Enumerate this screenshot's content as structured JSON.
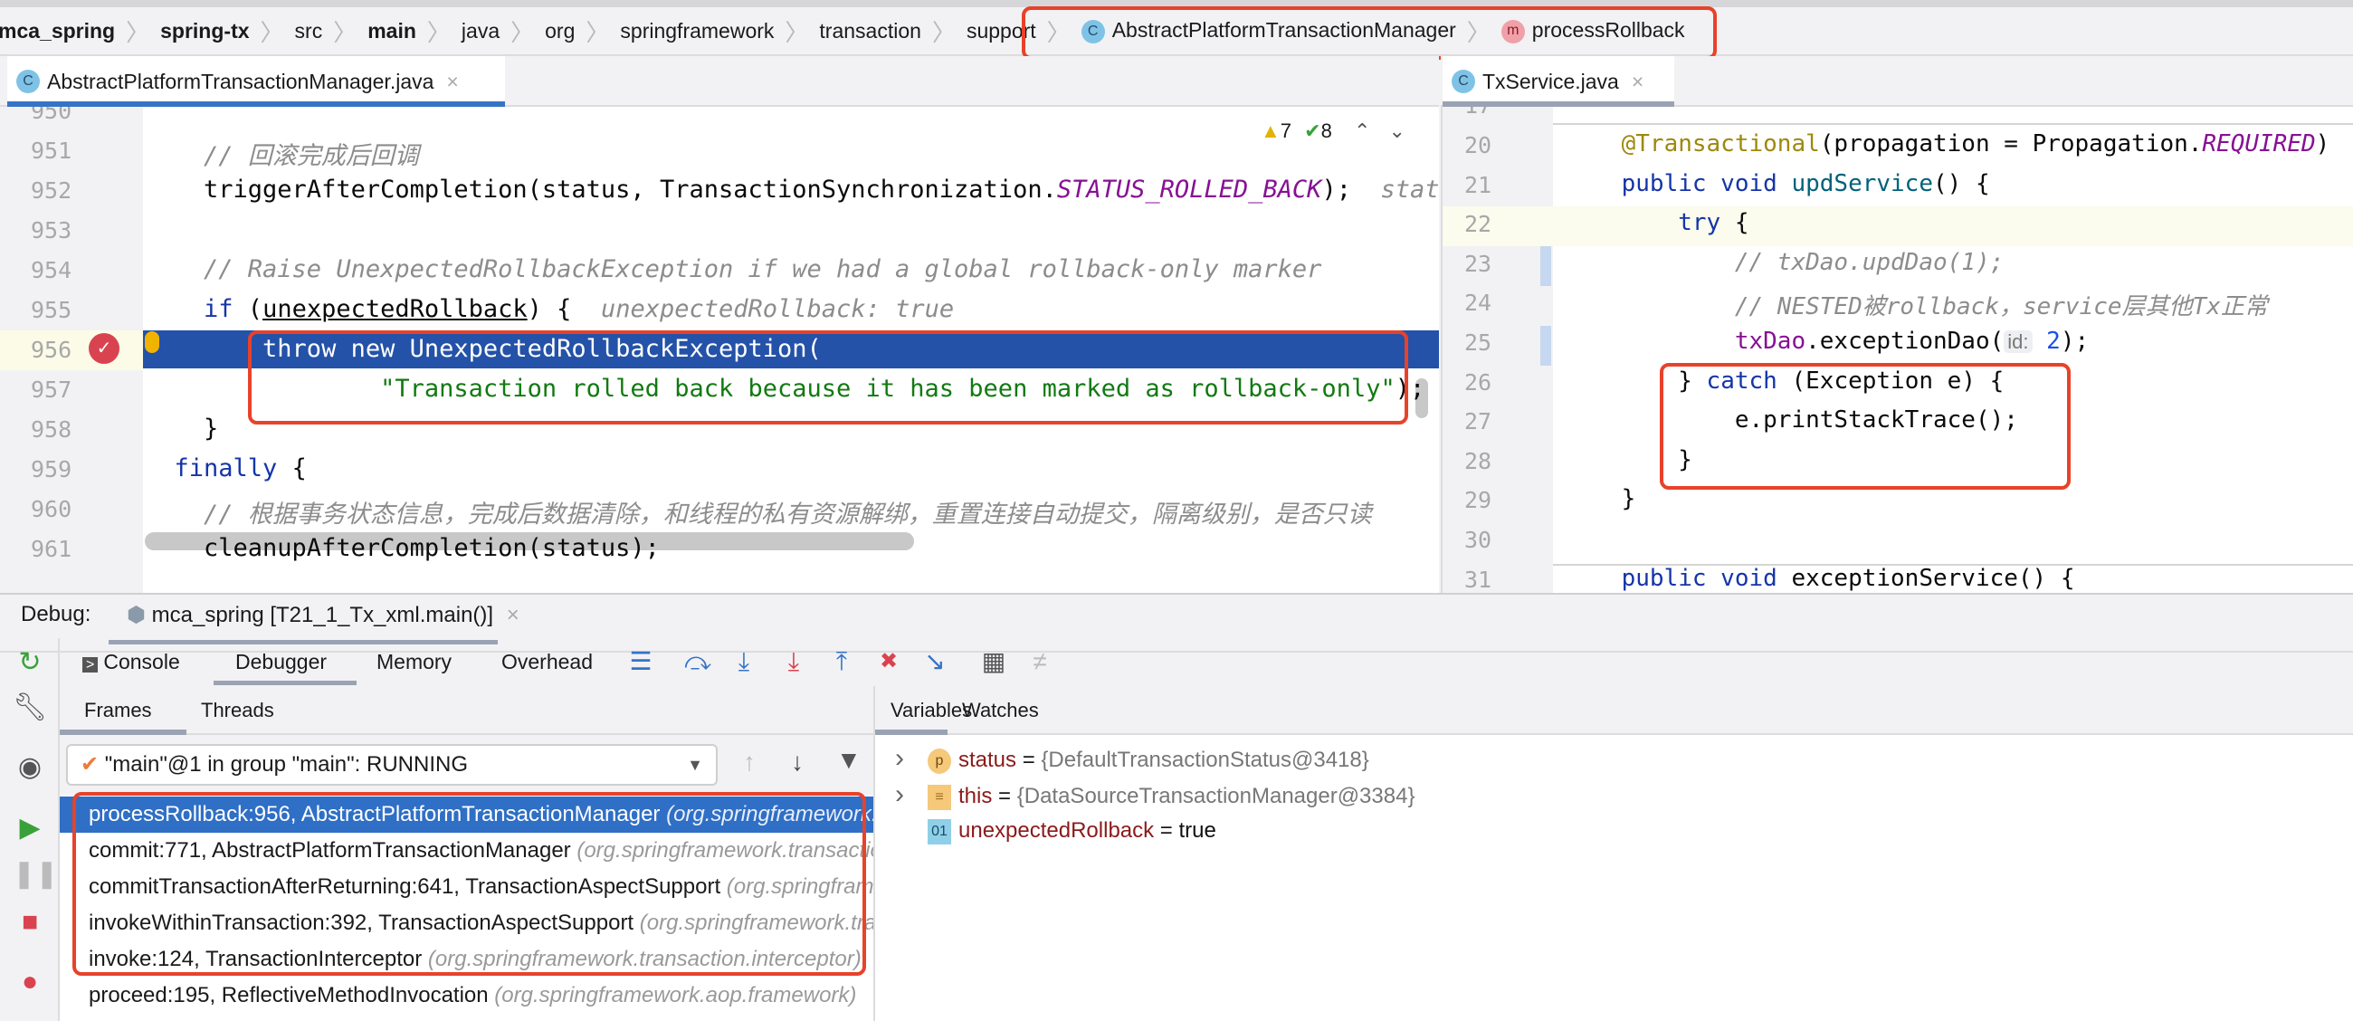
{
  "breadcrumb": {
    "items": [
      "mca_spring",
      "spring-tx",
      "src",
      "main",
      "java",
      "org",
      "springframework",
      "transaction",
      "support"
    ],
    "class_icon": "C",
    "class_name": "AbstractPlatformTransactionManager",
    "method_icon": "m",
    "method_name": "processRollback"
  },
  "left_editor": {
    "tab_label": "AbstractPlatformTransactionManager.java",
    "warnings": "7",
    "checks": "8",
    "lines": [
      {
        "num": "950",
        "tokens": []
      },
      {
        "num": "951",
        "tokens": [
          {
            "c": "cm",
            "t": "    // 回滚完成后回调"
          }
        ]
      },
      {
        "num": "952",
        "tokens": [
          {
            "c": "pl",
            "t": "    triggerAfterCompletion(status, TransactionSynchronization."
          },
          {
            "c": "cn",
            "t": "STATUS_ROLLED_BACK"
          },
          {
            "c": "pl",
            "t": ");"
          },
          {
            "c": "hn",
            "t": "  statu"
          }
        ]
      },
      {
        "num": "953",
        "tokens": []
      },
      {
        "num": "954",
        "tokens": [
          {
            "c": "cm",
            "t": "    // Raise UnexpectedRollbackException if we had a global rollback-only marker"
          }
        ]
      },
      {
        "num": "955",
        "tokens": [
          {
            "c": "kw",
            "t": "    if"
          },
          {
            "c": "pl",
            "t": " ("
          },
          {
            "c": "ul",
            "t": "unexpectedRollback"
          },
          {
            "c": "pl",
            "t": ") {"
          },
          {
            "c": "hn",
            "t": "  unexpectedRollback: true"
          }
        ]
      },
      {
        "num": "956",
        "tokens": [
          {
            "c": "hl",
            "t": "        throw new UnexpectedRollbackException("
          }
        ]
      },
      {
        "num": "957",
        "tokens": [
          {
            "c": "st",
            "t": "                \"Transaction rolled back because it has been marked as rollback-only\""
          },
          {
            "c": "pl",
            "t": ");"
          }
        ]
      },
      {
        "num": "958",
        "tokens": [
          {
            "c": "pl",
            "t": "    }"
          }
        ]
      },
      {
        "num": "959",
        "tokens": [
          {
            "c": "kw",
            "t": "  finally"
          },
          {
            "c": "pl",
            "t": " {"
          }
        ]
      },
      {
        "num": "960",
        "tokens": [
          {
            "c": "cm",
            "t": "    // 根据事务状态信息，完成后数据清除，和线程的私有资源解绑，重置连接自动提交，隔离级别，是否只读"
          }
        ]
      },
      {
        "num": "961",
        "tokens": [
          {
            "c": "pl",
            "t": "    cleanupAfterCompletion(status);"
          }
        ]
      }
    ]
  },
  "right_editor": {
    "tab_label": "TxService.java",
    "lines": [
      {
        "num": "17",
        "tokens": []
      },
      {
        "num": "20",
        "tokens": [
          {
            "c": "an",
            "t": "    @Transactional"
          },
          {
            "c": "pl",
            "t": "(propagation = Propagation."
          },
          {
            "c": "cn",
            "t": "REQUIRED"
          },
          {
            "c": "pl",
            "t": ")"
          }
        ]
      },
      {
        "num": "21",
        "tokens": [
          {
            "c": "kw",
            "t": "    public void "
          },
          {
            "c": "fn",
            "t": "updService"
          },
          {
            "c": "pl",
            "t": "() {"
          }
        ]
      },
      {
        "num": "22",
        "tokens": [
          {
            "c": "kw",
            "t": "        try"
          },
          {
            "c": "pl",
            "t": " {"
          }
        ]
      },
      {
        "num": "23",
        "tokens": [
          {
            "c": "cm",
            "t": "            // txDao.updDao(1);"
          }
        ]
      },
      {
        "num": "24",
        "tokens": [
          {
            "c": "cm",
            "t": "            // NESTED被rollback，service层其他Tx正常"
          }
        ]
      },
      {
        "num": "25",
        "tokens": [
          {
            "c": "fd",
            "t": "            txDao"
          },
          {
            "c": "pl",
            "t": ".exceptionDao("
          },
          {
            "c": "hint",
            "t": "id:"
          },
          {
            "c": "nu",
            "t": " 2"
          },
          {
            "c": "pl",
            "t": ");"
          }
        ]
      },
      {
        "num": "26",
        "tokens": [
          {
            "c": "pl",
            "t": "        } "
          },
          {
            "c": "kw",
            "t": "catch"
          },
          {
            "c": "pl",
            "t": " (Exception e) {"
          }
        ]
      },
      {
        "num": "27",
        "tokens": [
          {
            "c": "pl",
            "t": "            e.printStackTrace();"
          }
        ]
      },
      {
        "num": "28",
        "tokens": [
          {
            "c": "pl",
            "t": "        }"
          }
        ]
      },
      {
        "num": "29",
        "tokens": [
          {
            "c": "pl",
            "t": "    }"
          }
        ]
      },
      {
        "num": "30",
        "tokens": []
      },
      {
        "num": "31",
        "tokens": [
          {
            "c": "kw",
            "t": "    public void "
          },
          {
            "c": "pl",
            "t": "exceptionService() {"
          }
        ]
      }
    ]
  },
  "debug": {
    "label": "Debug:",
    "session_tab": "mca_spring [T21_1_Tx_xml.main()]",
    "tabs": [
      "Console",
      "Debugger",
      "Memory",
      "Overhead"
    ],
    "frames_tabs": [
      "Frames",
      "Threads"
    ],
    "thread_select": "\"main\"@1 in group \"main\": RUNNING",
    "frames": [
      {
        "method": "processRollback:956, AbstractPlatformTransactionManager ",
        "pkg": "(org.springframework.transaction.support)"
      },
      {
        "method": "commit:771, AbstractPlatformTransactionManager ",
        "pkg": "(org.springframework.transaction.support)"
      },
      {
        "method": "commitTransactionAfterReturning:641, TransactionAspectSupport ",
        "pkg": "(org.springframework.transaction.interceptor)"
      },
      {
        "method": "invokeWithinTransaction:392, TransactionAspectSupport ",
        "pkg": "(org.springframework.transaction.interceptor)"
      },
      {
        "method": "invoke:124, TransactionInterceptor ",
        "pkg": "(org.springframework.transaction.interceptor)"
      },
      {
        "method": "proceed:195, ReflectiveMethodInvocation ",
        "pkg": "(org.springframework.aop.framework)"
      }
    ],
    "var_tabs": [
      "Variables",
      "Watches"
    ],
    "variables": [
      {
        "icon": "p",
        "name": "status",
        "eq": " = ",
        "value": "{DefaultTransactionStatus@3418}"
      },
      {
        "icon": "≡",
        "name": "this",
        "eq": " = ",
        "value": "{DataSourceTransactionManager@3384}"
      },
      {
        "icon": "01",
        "name": "unexpectedRollback",
        "eq": " = ",
        "value": "true"
      }
    ]
  },
  "colors": {
    "accent": "#3574c5",
    "highlight_line": "#2452a8",
    "selected_frame": "#2f6fc5",
    "annotation_box": "#e8422b"
  }
}
